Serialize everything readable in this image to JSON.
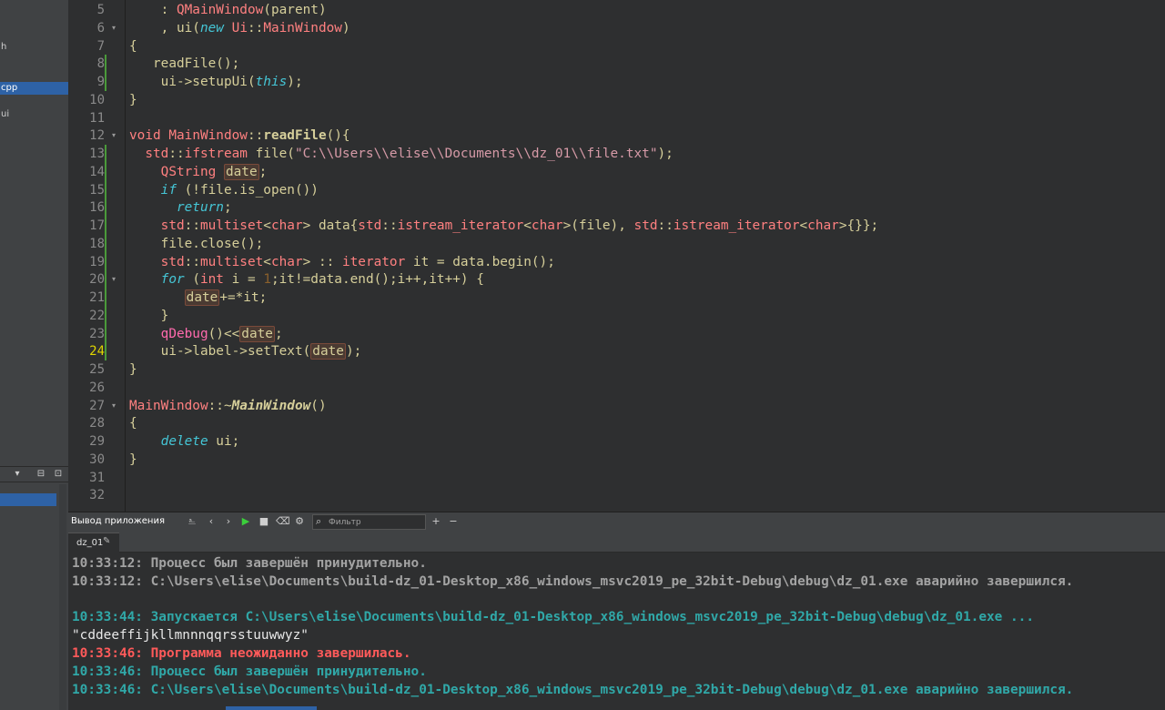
{
  "sidebar": {
    "items": [
      {
        "label": "h",
        "selected": false
      },
      {
        "label": "cpp",
        "selected": true
      },
      {
        "label": "ui",
        "selected": false
      }
    ],
    "toolbar": {
      "split_icon": "split-icon",
      "close_icon": "close-icon"
    }
  },
  "editor": {
    "current_line": "24",
    "lines": [
      {
        "n": "5"
      },
      {
        "n": "6"
      },
      {
        "n": "7"
      },
      {
        "n": "8"
      },
      {
        "n": "9"
      },
      {
        "n": "10"
      },
      {
        "n": "11"
      },
      {
        "n": "12"
      },
      {
        "n": "13"
      },
      {
        "n": "14"
      },
      {
        "n": "15"
      },
      {
        "n": "16"
      },
      {
        "n": "17"
      },
      {
        "n": "18"
      },
      {
        "n": "19"
      },
      {
        "n": "20"
      },
      {
        "n": "21"
      },
      {
        "n": "22"
      },
      {
        "n": "23"
      },
      {
        "n": "24"
      },
      {
        "n": "25"
      },
      {
        "n": "26"
      },
      {
        "n": "27"
      },
      {
        "n": "28"
      },
      {
        "n": "29"
      },
      {
        "n": "30"
      },
      {
        "n": "31"
      },
      {
        "n": "32"
      }
    ],
    "code": {
      "l5": [
        "    : ",
        "QMainWindow",
        "(parent)"
      ],
      "l6": [
        "    , ui(",
        "new",
        " ",
        "Ui",
        "::",
        "MainWindow",
        ")"
      ],
      "l7": [
        "{"
      ],
      "l8": [
        "   readFile();"
      ],
      "l9": [
        "    ui->setupUi(",
        "this",
        ");"
      ],
      "l10": [
        "}"
      ],
      "l11": [
        ""
      ],
      "l12": [
        "void",
        " ",
        "MainWindow",
        "::",
        "readFile",
        "(){"
      ],
      "l13": [
        "  ",
        "std",
        "::",
        "ifstream",
        " file(",
        "\"C:\\\\Users\\\\elise\\\\Documents\\\\dz_01\\\\file.txt\"",
        ");"
      ],
      "l14": [
        "    ",
        "QString",
        " ",
        "date",
        ";"
      ],
      "l15": [
        "    ",
        "if",
        " (!file.is_open())"
      ],
      "l16": [
        "      ",
        "return",
        ";"
      ],
      "l17": [
        "    ",
        "std",
        "::",
        "multiset",
        "<",
        "char",
        "> data{",
        "std",
        "::",
        "istream_iterator",
        "<",
        "char",
        ">(file), ",
        "std",
        "::",
        "istream_iterator",
        "<",
        "char",
        ">{}};"
      ],
      "l18": [
        "    file.close();"
      ],
      "l19": [
        "    ",
        "std",
        "::",
        "multiset",
        "<",
        "char",
        "> :: ",
        "iterator",
        " it = data.begin();"
      ],
      "l20": [
        "    ",
        "for",
        " (",
        "int",
        " i = ",
        "1",
        ";it!=data.end();i++,it++) {"
      ],
      "l21": [
        "       ",
        "date",
        "+=*it;"
      ],
      "l22": [
        "    }"
      ],
      "l23": [
        "    ",
        "qDebug",
        "()<<",
        "date",
        ";"
      ],
      "l24": [
        "    ui->label->setText(",
        "date",
        ");"
      ],
      "l25": [
        "}"
      ],
      "l26": [
        ""
      ],
      "l27": [
        "MainWindow",
        "::~",
        "MainWindow",
        "()"
      ],
      "l28": [
        "{"
      ],
      "l29": [
        "    ",
        "delete",
        " ui;"
      ],
      "l30": [
        "}"
      ],
      "l31": [
        ""
      ],
      "l32": [
        ""
      ]
    }
  },
  "output_pane": {
    "title": "Вывод приложения",
    "filter_placeholder": "Фильтр",
    "tab_label": "dz_01",
    "lines": [
      {
        "text": "10:33:12: Процесс был завершён принудительно.",
        "style": "gray"
      },
      {
        "text": "10:33:12: C:\\Users\\elise\\Documents\\build-dz_01-Desktop_x86_windows_msvc2019_pe_32bit-Debug\\debug\\dz_01.exe аварийно завершился.",
        "style": "gray"
      },
      {
        "text": "",
        "style": "gray"
      },
      {
        "text": "10:33:44: Запускается C:\\Users\\elise\\Documents\\build-dz_01-Desktop_x86_windows_msvc2019_pe_32bit-Debug\\debug\\dz_01.exe ...",
        "style": "teal"
      },
      {
        "text": "\"cddeeffijkllmnnnqqrsstuuwwyz\"",
        "style": "plain"
      },
      {
        "text": "10:33:46: Программа неожиданно завершилась.",
        "style": "red"
      },
      {
        "text": "10:33:46: Процесс был завершён принудительно.",
        "style": "teal"
      },
      {
        "text": "10:33:46: C:\\Users\\elise\\Documents\\build-dz_01-Desktop_x86_windows_msvc2019_pe_32bit-Debug\\debug\\dz_01.exe аварийно завершился.",
        "style": "teal"
      }
    ]
  },
  "colors": {
    "background": "#2e2f30",
    "panel": "#404244",
    "selection": "#2e62a6",
    "keyword": "#45c6d6",
    "type": "#ff8080",
    "string": "#d69aa7",
    "teal_output": "#30a8a8",
    "error_output": "#ff5a5a"
  }
}
